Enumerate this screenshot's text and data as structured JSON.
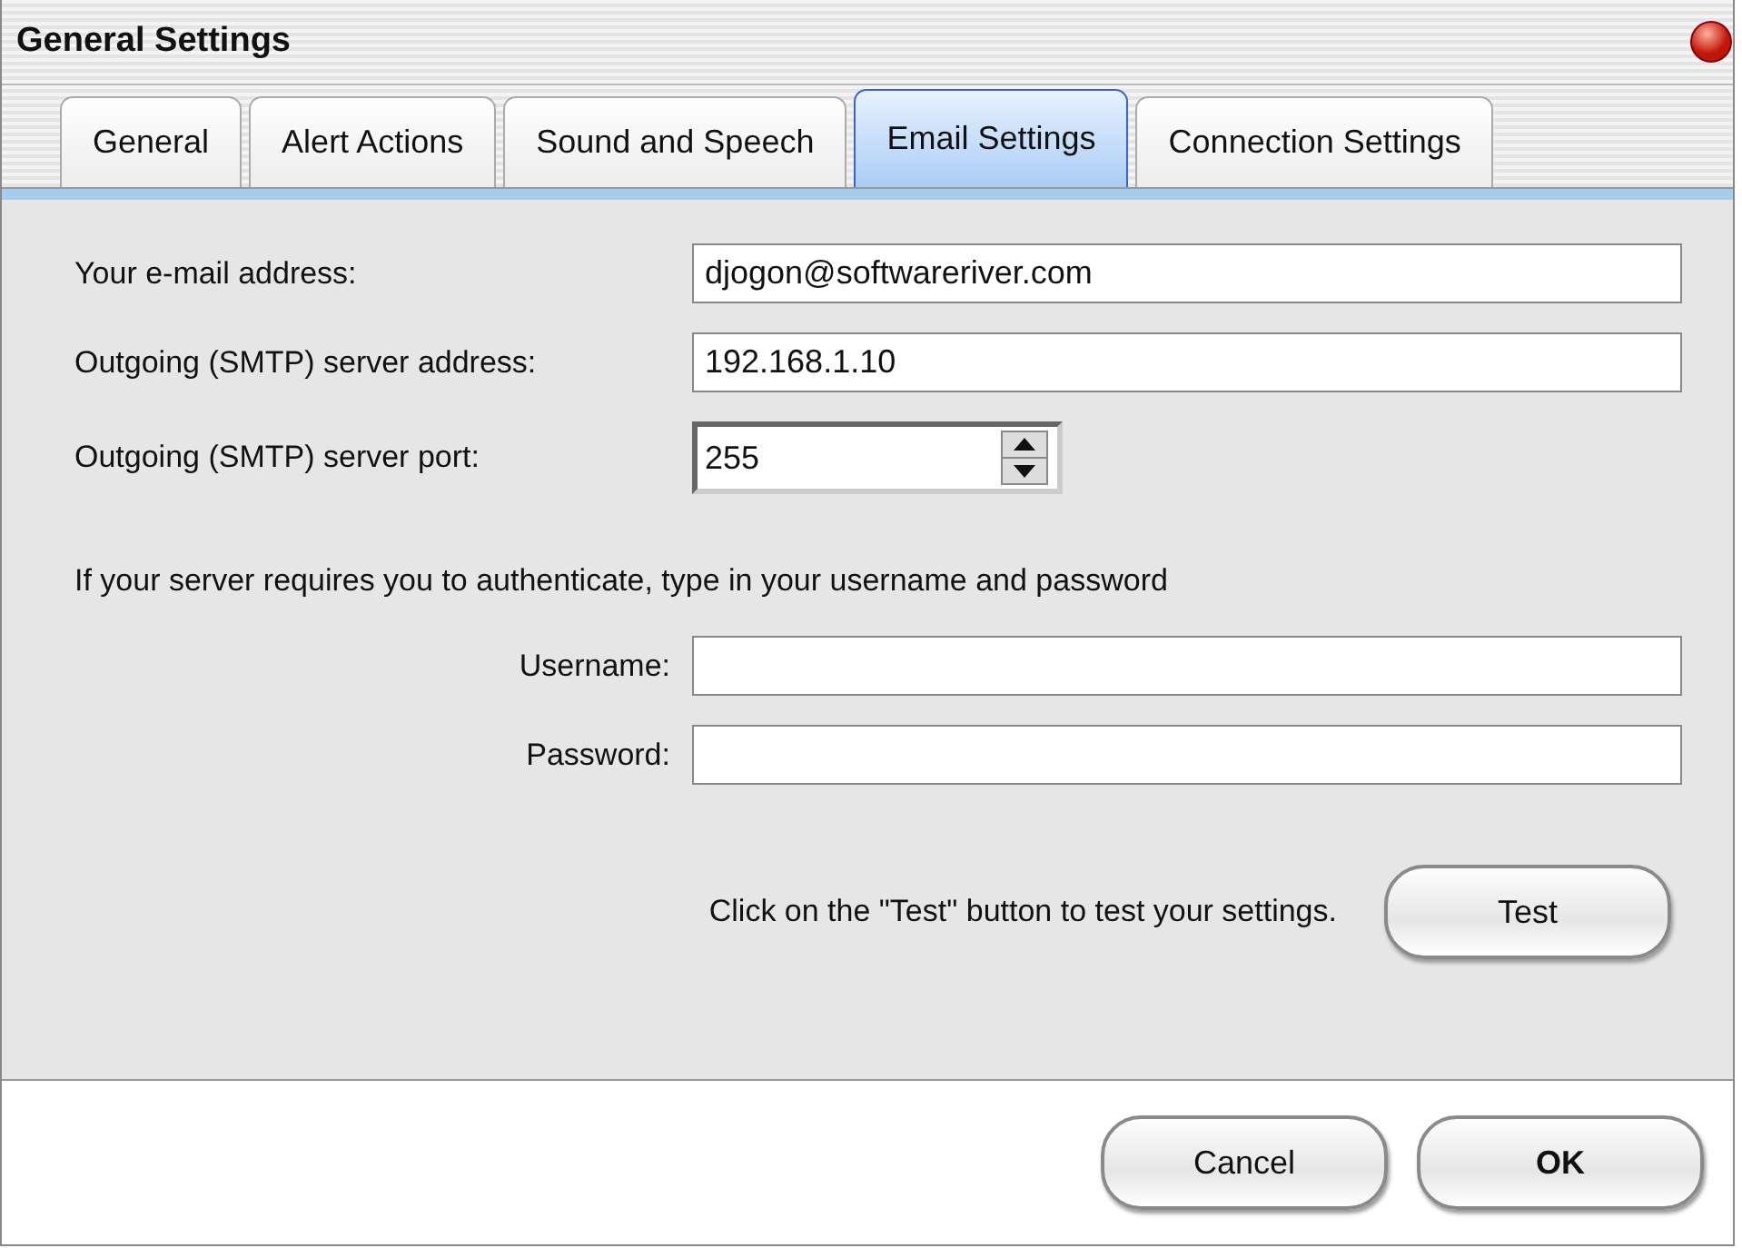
{
  "window": {
    "title": "General Settings"
  },
  "tabs": [
    {
      "label": "General",
      "selected": false
    },
    {
      "label": "Alert Actions",
      "selected": false
    },
    {
      "label": "Sound and Speech",
      "selected": false
    },
    {
      "label": "Email Settings",
      "selected": true
    },
    {
      "label": "Connection Settings",
      "selected": false
    }
  ],
  "fields": [
    {
      "kind": "text",
      "label": "Your e-mail address:",
      "value": "djogon@softwareriver.com"
    },
    {
      "kind": "text",
      "label": "Outgoing (SMTP) server address:",
      "value": "192.168.1.10"
    },
    {
      "kind": "spinner",
      "label": "Outgoing (SMTP) server port:",
      "value": "255"
    }
  ],
  "auth_note": "If your server requires you to authenticate, type in your username and password",
  "auth_fields": [
    {
      "label": "Username:"
    },
    {
      "label": "Password:"
    }
  ],
  "test": {
    "note": "Click on the \"Test\" button to test your settings.",
    "button": "Test"
  },
  "buttons": [
    {
      "label": "Cancel",
      "default": false
    },
    {
      "label": "OK",
      "default": true
    }
  ]
}
